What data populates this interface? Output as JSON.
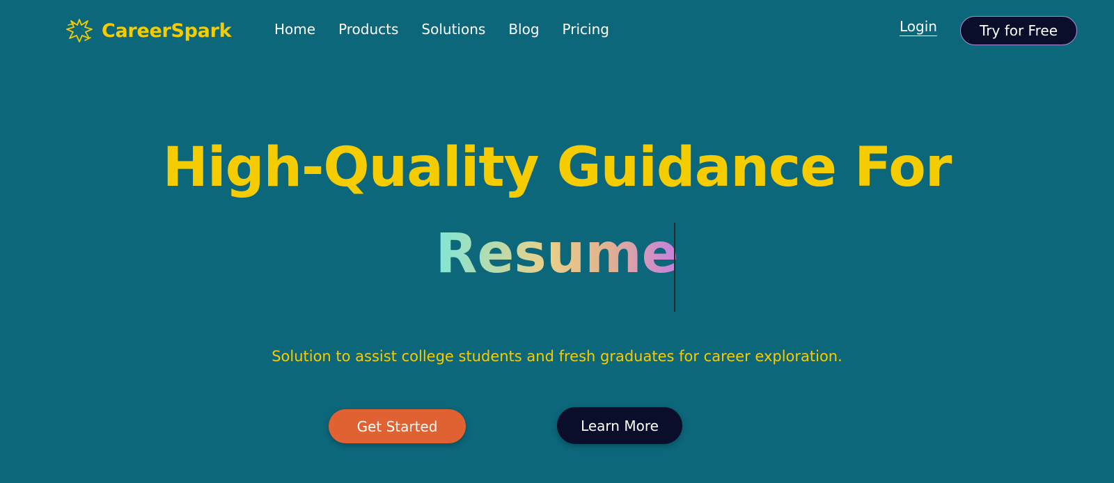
{
  "brand": {
    "name": "CareerSpark",
    "icon": "spark-logo-icon",
    "color": "#f5cc00"
  },
  "nav": {
    "links": [
      "Home",
      "Products",
      "Solutions",
      "Blog",
      "Pricing"
    ],
    "login_label": "Login",
    "cta_label": "Try for Free"
  },
  "hero": {
    "title": "High-Quality Guidance For",
    "rotating_word": "Resume",
    "subtitle": "Solution to assist college students and fresh graduates for career exploration.",
    "primary_button": "Get Started",
    "secondary_button": "Learn More"
  },
  "colors": {
    "background": "#0c677a",
    "accent_yellow": "#f5cc00",
    "primary_button": "#e06132",
    "dark_button": "#0b0e2a"
  }
}
